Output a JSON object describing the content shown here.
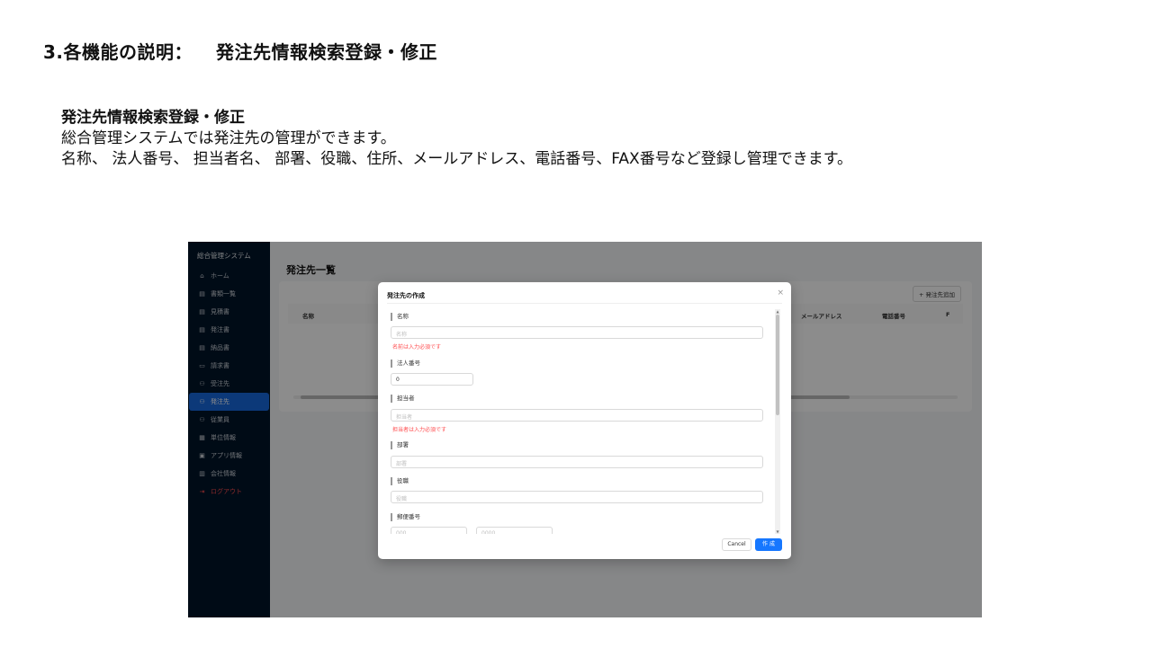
{
  "document": {
    "heading_number": "3.各機能の説明：",
    "heading_title": "発注先情報検索登録・修正",
    "section_title": "発注先情報検索登録・修正",
    "section_line1": "総合管理システムでは発注先の管理ができます。",
    "section_line2": "名称、 法人番号、 担当者名、 部署、役職、住所、メールアドレス、電話番号、FAX番号など登録し管理できます。"
  },
  "app": {
    "brand": "総合管理システム",
    "sidebar": {
      "items": [
        {
          "label": "ホーム",
          "icon": "home-icon",
          "glyph": "⌂"
        },
        {
          "label": "書類一覧",
          "icon": "list-icon",
          "glyph": "▤"
        },
        {
          "label": "見積書",
          "icon": "document-icon",
          "glyph": "▤"
        },
        {
          "label": "発注書",
          "icon": "document-icon",
          "glyph": "▤"
        },
        {
          "label": "納品書",
          "icon": "document-icon",
          "glyph": "▤"
        },
        {
          "label": "請求書",
          "icon": "card-icon",
          "glyph": "▭"
        },
        {
          "label": "受注先",
          "icon": "user-icon",
          "glyph": "⚇"
        },
        {
          "label": "発注先",
          "icon": "user-icon",
          "glyph": "⚇",
          "active": true
        },
        {
          "label": "従業員",
          "icon": "user-icon",
          "glyph": "⚇"
        },
        {
          "label": "単位情報",
          "icon": "grid-icon",
          "glyph": "▦"
        },
        {
          "label": "アプリ情報",
          "icon": "app-icon",
          "glyph": "▣"
        },
        {
          "label": "会社情報",
          "icon": "building-icon",
          "glyph": "▥"
        }
      ],
      "logout": {
        "label": "ログアウト",
        "icon": "logout-icon",
        "glyph": "⇥"
      }
    },
    "page_title": "発注先一覧",
    "add_button": "+ 発注先追加",
    "table_headers": [
      "名称",
      "メールアドレス",
      "電話番号",
      "F"
    ]
  },
  "modal": {
    "title": "発注先の作成",
    "close_glyph": "×",
    "fields": {
      "name_label": "名称",
      "name_placeholder": "名称",
      "name_error": "名前は入力必須です",
      "corp_label": "法人番号",
      "corp_value": "0",
      "person_label": "担当者",
      "person_placeholder": "担当者",
      "person_error": "担当者は入力必須です",
      "dept_label": "部署",
      "dept_placeholder": "部署",
      "role_label": "役職",
      "role_placeholder": "役職",
      "zip_label": "郵便番号",
      "zip1_placeholder": "000",
      "zip2_placeholder": "0000"
    },
    "cancel_label": "Cancel",
    "create_label": "作 成"
  },
  "colors": {
    "sidebar_bg": "#001529",
    "active_item": "#1668dc",
    "primary_button": "#1677ff",
    "error_text": "#ff4d4f"
  }
}
